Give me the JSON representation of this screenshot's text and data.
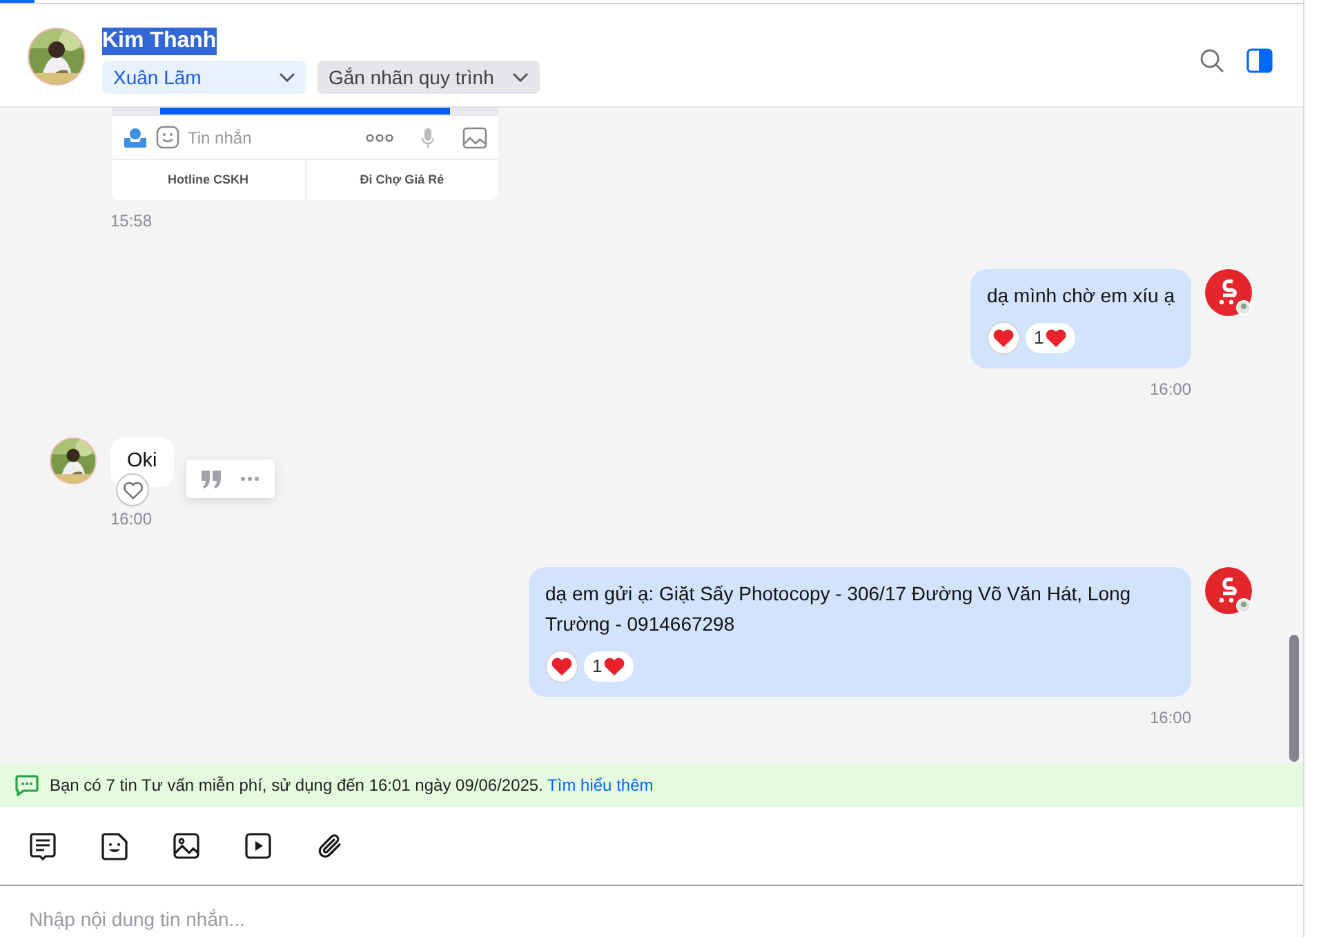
{
  "header": {
    "contact_name": "Kim Thanh",
    "name_highlighted": true,
    "assignee": "Xuân Lãm",
    "label_dropdown": "Gắn nhãn quy trình"
  },
  "messages": [
    {
      "kind": "mini_app_card",
      "card": {
        "input_placeholder": "Tin nhắn",
        "buttons": [
          "Hotline CSKH",
          "Đi Chợ Giá Rẻ"
        ]
      },
      "time": "15:58"
    },
    {
      "kind": "outgoing_text",
      "text": "dạ mình chờ em xíu ạ",
      "reaction_count": "1",
      "time": "16:00"
    },
    {
      "kind": "incoming_text",
      "text": "Oki",
      "hover_actions": true,
      "time": "16:00"
    },
    {
      "kind": "outgoing_text",
      "text": "dạ em gửi ạ: Giặt Sấy Photocopy - 306/17 Đường Võ Văn Hát, Long Trường - 0914667298",
      "reaction_count": "1",
      "time": "16:00"
    }
  ],
  "notice": {
    "text": "Bạn có 7 tin Tư vấn miễn phí, sử dụng đến 16:01 ngày 09/06/2025.",
    "link": "Tìm hiểu thêm"
  },
  "composer": {
    "placeholder": "Nhập nội dung tin nhắn..."
  }
}
